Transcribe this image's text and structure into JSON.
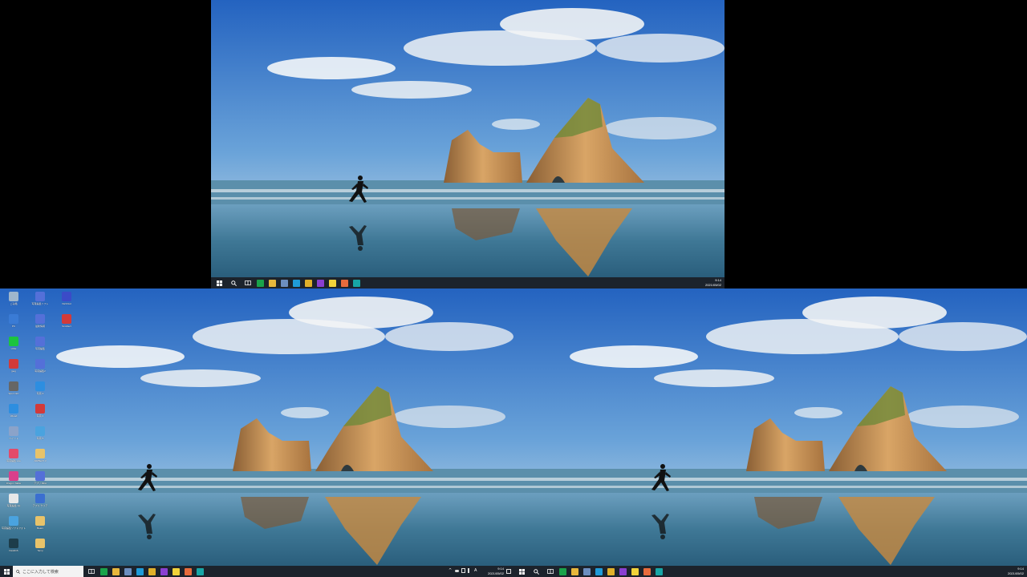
{
  "colors": {
    "taskbar": "#1c232c",
    "sky_top": "#2f6fc6",
    "sky_bottom": "#bcd3e3",
    "rock": "#b98a52",
    "sea": "#3f7896"
  },
  "taskbar": {
    "start_icon": "windows-logo-icon",
    "search_icon": "search-icon",
    "taskview_icon": "task-view-icon",
    "pinned_apps": [
      {
        "icon": "green-app-icon",
        "color": "#1aa34a"
      },
      {
        "icon": "file-explorer-icon",
        "color": "#e6b73c"
      },
      {
        "icon": "document-app-icon",
        "color": "#6c8ebf"
      },
      {
        "icon": "edge-browser-icon",
        "color": "#1f9bd8"
      },
      {
        "icon": "chrome-browser-icon",
        "color": "#e0b02a"
      },
      {
        "icon": "purple-app-icon",
        "color": "#8a3fd1"
      },
      {
        "icon": "sticky-notes-icon",
        "color": "#f1d33a"
      },
      {
        "icon": "paint-app-icon",
        "color": "#e86b3c"
      },
      {
        "icon": "teal-app-icon",
        "color": "#17a6a6"
      }
    ],
    "clock_time": "9:14",
    "clock_date": "2021/05/02"
  },
  "search": {
    "placeholder": "ここに入力して検索"
  },
  "desktop_icons": [
    {
      "label": "ごみ箱",
      "color": "#9fb6cc"
    },
    {
      "label": "PC",
      "color": "#3a7bd5"
    },
    {
      "label": "LINE",
      "color": "#1cc43f"
    },
    {
      "label": "jpeg",
      "color": "#d23a3a"
    },
    {
      "label": "Spec calc",
      "color": "#666"
    },
    {
      "label": "xRead",
      "color": "#2d8ee0"
    },
    {
      "label": "ペイント",
      "color": "#8ba3c9"
    },
    {
      "label": "写真編集.exe",
      "color": "#e24b6a"
    },
    {
      "label": "Dragon Talkie",
      "color": "#d9408b"
    },
    {
      "label": "写真編集.zip",
      "color": "#e8e8e8"
    },
    {
      "label": "写真編集ソフトフォト",
      "color": "#4aa3df"
    },
    {
      "label": "DeskGS",
      "color": "#1d3d4a"
    },
    {
      "label": "写真編集ソフト",
      "color": "#5470d8"
    },
    {
      "label": "最新情報",
      "color": "#5470d8"
    },
    {
      "label": "写真編集",
      "color": "#5470d8"
    },
    {
      "label": "写真編集2",
      "color": "#5470d8"
    },
    {
      "label": "写真 3",
      "color": "#2d8ee0"
    },
    {
      "label": "写真 4",
      "color": "#d23a3a"
    },
    {
      "label": "写真 5",
      "color": "#4aa3df"
    },
    {
      "label": "AIRBEAT 3",
      "color": "#e8c36a"
    },
    {
      "label": "アプリ MFA",
      "color": "#5470d8"
    },
    {
      "label": "アプリ クリア",
      "color": "#3b6fd0"
    },
    {
      "label": "Bears",
      "color": "#e8c36a"
    },
    {
      "label": "Temp",
      "color": "#e8c36a"
    },
    {
      "label": "fileVNsd",
      "color": "#3b4bc8"
    },
    {
      "label": "SnoRect",
      "color": "#d23a3a"
    }
  ]
}
